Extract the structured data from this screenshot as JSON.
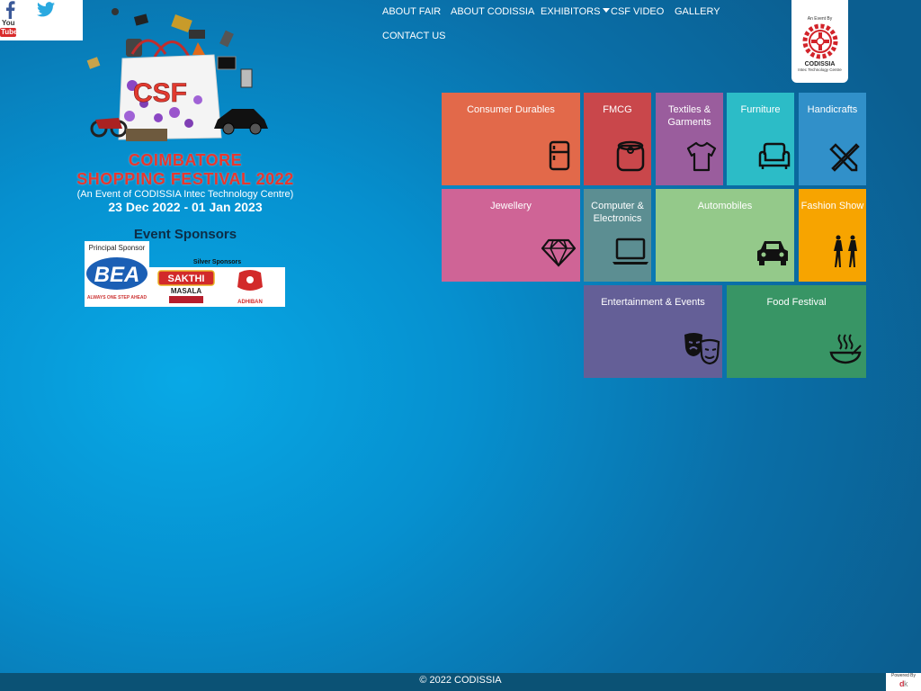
{
  "social": {
    "facebook_icon": "facebook-icon",
    "twitter_icon": "twitter-icon",
    "youtube_you": "You",
    "youtube_tube": "Tube"
  },
  "nav": {
    "about_fair": "ABOUT FAIR",
    "about_codissia": "ABOUT CODISSIA",
    "exhibitors": "EXHIBITORS",
    "csf_video": "CSF VIDEO",
    "gallery": "GALLERY",
    "contact_us": "CONTACT US"
  },
  "codissia": {
    "an_event_by": "An Event By",
    "name": "CODISSIA",
    "sub": "Intec Technology Centre"
  },
  "hero": {
    "bag_text": "CSF",
    "title_line1": "COIMBATORE",
    "title_line2": "SHOPPING FESTIVAL 2022",
    "event_of": "(An Event of CODISSIA Intec Technology Centre)",
    "dates": "23 Dec 2022 - 01 Jan 2023"
  },
  "sponsors": {
    "heading": "Event Sponsors",
    "principal_label": "Principal Sponsor",
    "principal_logo": "BEA",
    "principal_tagline": "ALWAYS ONE STEP AHEAD",
    "silver_label": "Silver Sponsors",
    "silver1": "SAKTHI",
    "silver1_sub": "MASALA",
    "silver2": "ADHIBAN"
  },
  "tiles": [
    {
      "label": "Consumer Durables",
      "color": "#e2694a",
      "icon": "refrigerator-icon"
    },
    {
      "label": "FMCG",
      "color": "#c9474b",
      "icon": "jar-icon"
    },
    {
      "label": "Textiles & Garments",
      "color": "#9a5d9d",
      "icon": "tshirt-icon"
    },
    {
      "label": "Furniture",
      "color": "#2cbcc7",
      "icon": "armchair-icon"
    },
    {
      "label": "Handicrafts",
      "color": "#3190c9",
      "icon": "tools-icon"
    },
    {
      "label": "Jewellery",
      "color": "#cf6496",
      "icon": "diamond-icon"
    },
    {
      "label": "Computer & Electronics",
      "color": "#5c8e92",
      "icon": "laptop-icon"
    },
    {
      "label": "Automobiles",
      "color": "#94c98a",
      "icon": "car-icon"
    },
    {
      "label": "Fashion Show",
      "color": "#f7a400",
      "icon": "models-icon"
    },
    {
      "label": "Entertainment & Events",
      "color": "#645f97",
      "icon": "theatre-masks-icon"
    },
    {
      "label": "Food Festival",
      "color": "#389565",
      "icon": "food-bowl-icon"
    }
  ],
  "footer": {
    "copyright": "© 2022 CODISSIA",
    "powered_by": "Powered By"
  }
}
